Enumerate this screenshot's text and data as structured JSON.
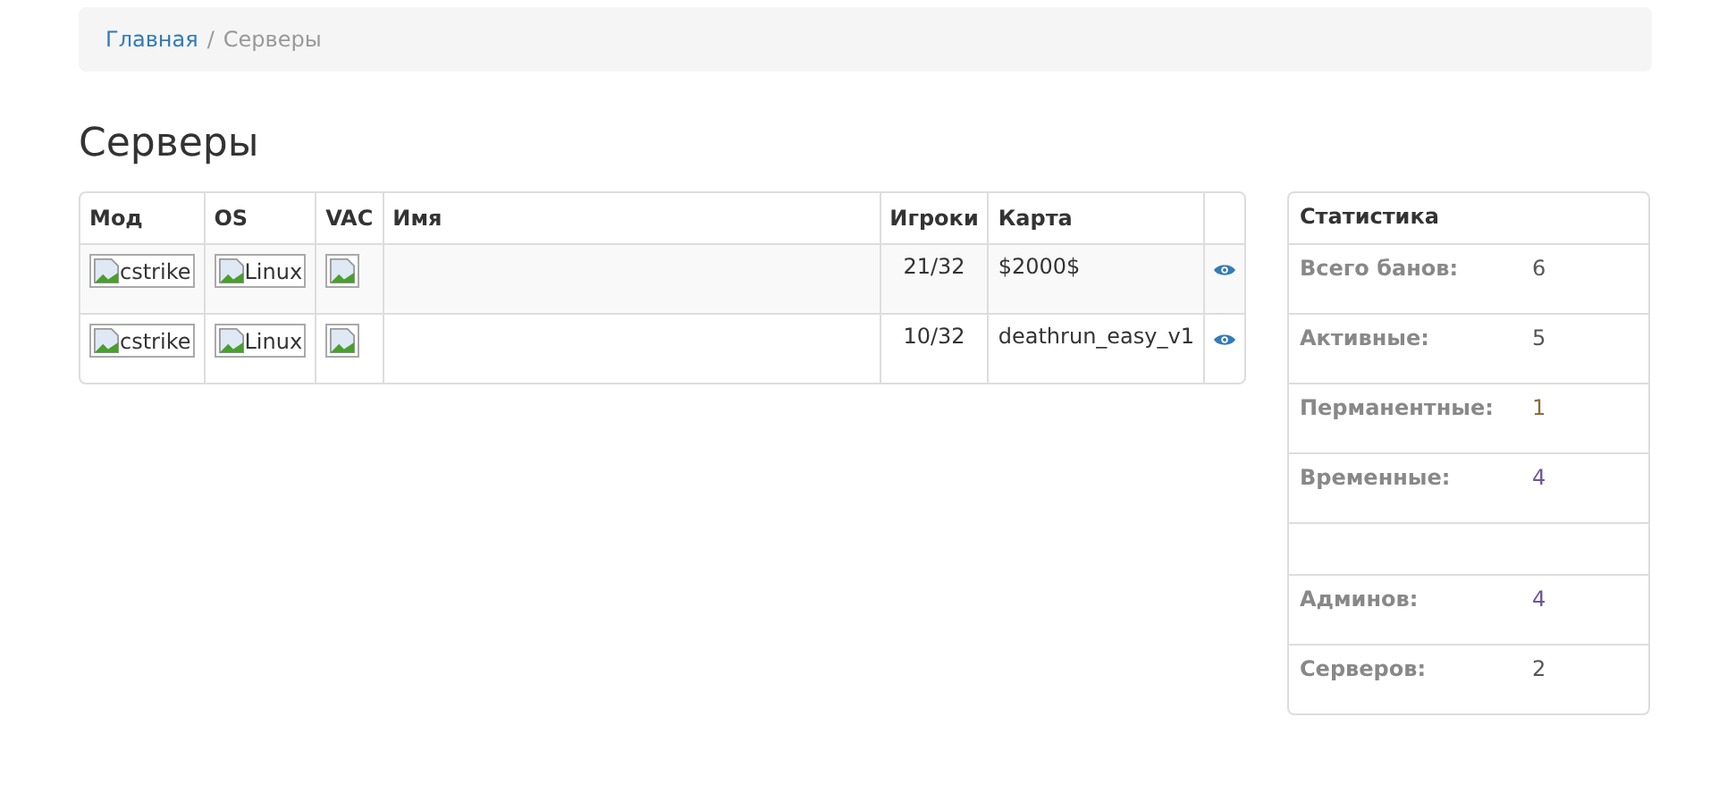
{
  "breadcrumb": [
    {
      "label": "Главная",
      "link": true
    },
    {
      "label": "Серверы",
      "link": false
    }
  ],
  "breadcrumb_separator": "/",
  "title": "Серверы",
  "table": {
    "columns": [
      "Мод",
      "OS",
      "VAC",
      "Имя",
      "Игроки",
      "Карта"
    ],
    "rows": [
      {
        "mod": "cstrike",
        "os": "Linux",
        "players": "21/32",
        "map": "$2000$"
      },
      {
        "mod": "cstrike",
        "os": "Linux",
        "players": "10/32",
        "map": "deathrun_easy_v1"
      }
    ]
  },
  "stats": {
    "title": "Статистика",
    "rows": [
      {
        "kind": "stat",
        "label": "Всего банов:",
        "value": "6",
        "color": "#555555"
      },
      {
        "kind": "stat",
        "label": "Активные:",
        "value": "5",
        "color": "#555555"
      },
      {
        "kind": "stat",
        "label": "Перманентные:",
        "value": "1",
        "color": "#8a6d3b"
      },
      {
        "kind": "stat",
        "label": "Временные:",
        "value": "4",
        "color": "#6f5499"
      },
      {
        "kind": "spacer"
      },
      {
        "kind": "stat",
        "label": "Админов:",
        "value": "4",
        "color": "#6f5499"
      },
      {
        "kind": "stat",
        "label": "Серверов:",
        "value": "2",
        "color": "#555555"
      }
    ]
  }
}
